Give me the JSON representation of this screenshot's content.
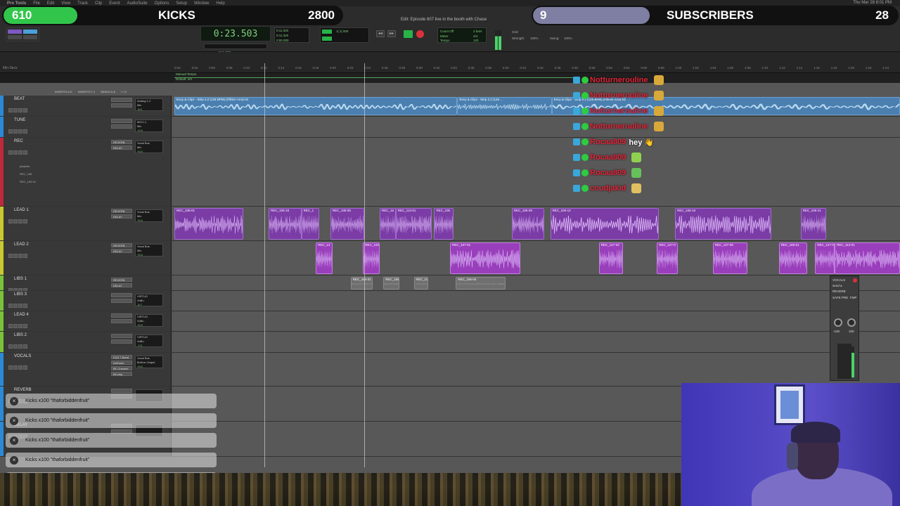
{
  "app": {
    "name": "Pro Tools",
    "window_title": "Edit: Episode 607 live in the booth with Chase",
    "menubar_items": [
      "Pro Tools",
      "File",
      "Edit",
      "View",
      "Track",
      "Clip",
      "Event",
      "AudioSuite",
      "Options",
      "Setup",
      "Window",
      "Help"
    ],
    "clock": "Thu Mar 28 8:01 PM"
  },
  "transport": {
    "main_counter": "0:23.503",
    "sub_start": "0:11.320",
    "sub_end": "0:11.320",
    "length": "0:00.000",
    "cursor": "0:11.320",
    "bars": "1| 1| 000",
    "tempo_labels": [
      "Count Off",
      "Meter",
      "Tempo"
    ],
    "count_off": "2 bars",
    "meter": "4/4",
    "tempo": "120",
    "grid_label": "Grid",
    "nudge_label": "Nudge",
    "strength": "Strength:",
    "strength_val": "100%",
    "swing": "Swing:",
    "swing_val": "100%"
  },
  "overlay": {
    "kicks": {
      "count": "610",
      "label": "KICKS",
      "goal": "2800",
      "accent": "#31c64b",
      "progress": 0.218
    },
    "subscribers": {
      "count": "9",
      "label": "SUBSCRIBERS",
      "goal": "28",
      "accent": "#7e7fa3",
      "progress": 0.32
    }
  },
  "ruler": {
    "rows": [
      "Min:Secs",
      "Tempo",
      "Meter",
      "Markers"
    ],
    "ticks": [
      "0:02",
      "0:04",
      "0:06",
      "0:08",
      "0:10",
      "0:12",
      "0:14",
      "0:16",
      "0:18",
      "0:20",
      "0:22",
      "0:24",
      "0:26",
      "0:28",
      "0:30",
      "0:32",
      "0:34",
      "0:36",
      "0:38",
      "0:40",
      "0:42",
      "0:44",
      "0:46",
      "0:48",
      "0:50",
      "0:52",
      "0:54",
      "0:56",
      "0:58",
      "1:00",
      "1:02",
      "1:04",
      "1:06",
      "1:08",
      "1:10",
      "1:12",
      "1:14",
      "1:16",
      "1:18",
      "1:20",
      "1:22",
      "1:24"
    ],
    "tempo_text": "Manual Tempo",
    "meter_text": "Default: 4/4",
    "col_headers": [
      "INSERTS A-E",
      "INSERTS F-J",
      "SENDS A-E",
      "I / O"
    ]
  },
  "tracks": [
    {
      "name": "BEAT",
      "color": "#2a8ad6",
      "ins": [
        "",
        ""
      ],
      "io": [
        "Analog 1-2",
        "Mix"
      ],
      "vol": "-8.0"
    },
    {
      "name": "TUNE",
      "color": "#2a8ad6",
      "ins": [
        "",
        ""
      ],
      "io": [
        "MIC1-1",
        "Mix"
      ],
      "vol": "+0.0"
    },
    {
      "name": "REC",
      "color": "#c0283c",
      "ins": [
        "REVERB",
        "DELAY"
      ],
      "io": [
        "Vocal Bus",
        "Mix"
      ],
      "vol": "+0.0",
      "sub": [
        "playlists",
        "REC_168",
        "REC_169-01"
      ]
    },
    {
      "name": "LEAD 1",
      "color": "#c8c832",
      "ins": [
        "REVERB",
        "DELAY"
      ],
      "io": [
        "Vocal Bus",
        "Mix"
      ],
      "vol": "+0.0"
    },
    {
      "name": "LEAD 2",
      "color": "#c8c832",
      "ins": [
        "REVERB",
        "DELAY"
      ],
      "io": [
        "Vocal Bus",
        "Mix"
      ],
      "vol": "+0.0"
    },
    {
      "name": "LIBS 1",
      "color": "#7ac23a",
      "ins": [
        "REVERB",
        "DELAY"
      ],
      "io": [
        "VIRTUO",
        "VoBu"
      ],
      "vol": "-7.0"
    },
    {
      "name": "LIBS 3",
      "color": "#7ac23a",
      "ins": [
        "",
        ""
      ],
      "io": [
        "VIRTUO",
        "VoBu"
      ],
      "vol": "-8.7"
    },
    {
      "name": "LEAD 4",
      "color": "#7ac23a",
      "ins": [
        "",
        ""
      ],
      "io": [
        "VIRTUO",
        "VoBu"
      ],
      "vol": "+0.0"
    },
    {
      "name": "LIBS 2",
      "color": "#7ac23a",
      "ins": [
        "",
        ""
      ],
      "io": [
        "VIRTUO",
        "VoBu"
      ],
      "vol": "-7.0"
    },
    {
      "name": "VOCALS",
      "color": "#2a8ad6",
      "ins": [
        "EQ3 7-Band",
        "DeEsser",
        "BF-Channel",
        "BComp"
      ],
      "io": [
        "Vocal Bus",
        "Built-in Output"
      ],
      "vol": "+0.0"
    },
    {
      "name": "REVERB",
      "color": "#2a8ad6",
      "ins": [
        "",
        ""
      ],
      "io": [
        "",
        ""
      ],
      "vol": ""
    },
    {
      "name": "DELAY",
      "color": "#2a8ad6",
      "ins": [
        "",
        ""
      ],
      "io": [
        "",
        ""
      ],
      "vol": ""
    }
  ],
  "clips": [
    {
      "track": 0,
      "name": "Envy & Clipz - Strip 2.2 (126 BPM) (Fillmin Arra)-01",
      "start": 0.0,
      "end": 0.39,
      "color": "blue"
    },
    {
      "track": 0,
      "name": "Envy & Clipz - Strip 2.2 (126 ...",
      "start": 0.39,
      "end": 0.52,
      "color": "blue"
    },
    {
      "track": 0,
      "name": "Envy & Clipz - Strip 2.2 (126 BPM) (Fillmin Arra)-02",
      "start": 0.52,
      "end": 1.0,
      "color": "blue"
    },
    {
      "track": 2,
      "name": "REC_135-01",
      "start": 0.175,
      "end": 0.265,
      "row": 0,
      "color": "purple"
    },
    {
      "track": 2,
      "name": "REC_109-01",
      "start": 0.265,
      "end": 0.37,
      "row": 0,
      "color": "purple"
    },
    {
      "track": 2,
      "name": "REC_131",
      "start": 0.148,
      "end": 0.265,
      "row": 1,
      "color": "violet"
    },
    {
      "track": 2,
      "name": "REC_109-01",
      "start": 0.278,
      "end": 0.357,
      "row": 1,
      "color": "violet"
    },
    {
      "track": 2,
      "name": "REC_118-01",
      "start": 0.466,
      "end": 0.516,
      "row": 0,
      "color": "purple"
    },
    {
      "track": 2,
      "name": "REC_...",
      "start": 0.834,
      "end": 0.86,
      "row": 1,
      "color": "violet"
    },
    {
      "track": 3,
      "name": "REC_105-01",
      "start": 0.0,
      "end": 0.095,
      "color": "lead"
    },
    {
      "track": 3,
      "name": "REC_105-15",
      "start": 0.13,
      "end": 0.175,
      "color": "lead"
    },
    {
      "track": 3,
      "name": "REC_1",
      "start": 0.175,
      "end": 0.2,
      "color": "lead"
    },
    {
      "track": 3,
      "name": "REC_105-05",
      "start": 0.215,
      "end": 0.262,
      "color": "lead"
    },
    {
      "track": 3,
      "name": "REC_15",
      "start": 0.283,
      "end": 0.305,
      "color": "lead"
    },
    {
      "track": 3,
      "name": "REC_113-01",
      "start": 0.305,
      "end": 0.355,
      "color": "lead"
    },
    {
      "track": 3,
      "name": "REC_105",
      "start": 0.358,
      "end": 0.385,
      "color": "lead"
    },
    {
      "track": 3,
      "name": "REC_105-09",
      "start": 0.465,
      "end": 0.51,
      "color": "lead"
    },
    {
      "track": 3,
      "name": "REC_105-12",
      "start": 0.518,
      "end": 0.668,
      "color": "lead"
    },
    {
      "track": 3,
      "name": "REC_105-16",
      "start": 0.69,
      "end": 0.823,
      "color": "lead"
    },
    {
      "track": 3,
      "name": "REC_105-21",
      "start": 0.863,
      "end": 0.898,
      "color": "lead"
    },
    {
      "track": 4,
      "name": "REC_14",
      "start": 0.195,
      "end": 0.218,
      "color": "hot"
    },
    {
      "track": 4,
      "name": "REC_103",
      "start": 0.26,
      "end": 0.283,
      "color": "hot"
    },
    {
      "track": 4,
      "name": "REC_107-01",
      "start": 0.38,
      "end": 0.477,
      "color": "hot"
    },
    {
      "track": 4,
      "name": "REC_127-03",
      "start": 0.585,
      "end": 0.618,
      "color": "hot"
    },
    {
      "track": 4,
      "name": "REC_127-0",
      "start": 0.665,
      "end": 0.694,
      "color": "hot"
    },
    {
      "track": 4,
      "name": "REC_127-06",
      "start": 0.742,
      "end": 0.79,
      "color": "hot"
    },
    {
      "track": 4,
      "name": "REC_169-01",
      "start": 0.833,
      "end": 0.872,
      "color": "hot"
    },
    {
      "track": 4,
      "name": "REC_127-0",
      "start": 0.883,
      "end": 0.91,
      "color": "hot"
    },
    {
      "track": 4,
      "name": "REC_113-01",
      "start": 0.91,
      "end": 1.0,
      "color": "hot"
    },
    {
      "track": 5,
      "name": "REC_164-01",
      "start": 0.243,
      "end": 0.273,
      "color": "grey"
    },
    {
      "track": 5,
      "name": "REC_166",
      "start": 0.288,
      "end": 0.31,
      "color": "grey"
    },
    {
      "track": 5,
      "name": "REC_1C",
      "start": 0.33,
      "end": 0.35,
      "color": "grey"
    },
    {
      "track": 5,
      "name": "REC_165-04",
      "start": 0.388,
      "end": 0.456,
      "color": "grey"
    }
  ],
  "chat": [
    {
      "user": "Notturnerouline",
      "msg": "",
      "emoji": "#d9a83a"
    },
    {
      "user": "Notturnerouline",
      "msg": "",
      "emoji": "#d9a83a"
    },
    {
      "user": "Notturnerouline",
      "msg": "",
      "emoji": "#d9a83a"
    },
    {
      "user": "Notturnerouline",
      "msg": "",
      "emoji": "#d9a83a"
    },
    {
      "user": "Rocaa809",
      "msg": "hey 👋",
      "emoji": ""
    },
    {
      "user": "Rocaa809",
      "msg": "",
      "emoji": "#8fd14f"
    },
    {
      "user": "Rocaa809",
      "msg": "",
      "emoji": "#67c15b"
    },
    {
      "user": "coudjakid",
      "msg": "",
      "emoji": "#e0c060"
    }
  ],
  "notifications": [
    {
      "text": "Kicks x100 \"thaforbiddenfruit\""
    },
    {
      "text": "Kicks x100 \"thaforbiddenfruit\""
    },
    {
      "text": "Kicks x100 \"thaforbiddenfruit\""
    },
    {
      "text": "Kicks x100 \"thaforbiddenfruit\""
    },
    {
      "text": "Kicks x100 \"thaforbiddenfruit\""
    }
  ],
  "mix_popup": {
    "title": "VOCALS",
    "sub": "send a",
    "reverb": "REVERB",
    "labels": [
      "SAFE",
      "PRE",
      "FMP"
    ],
    "values": [
      "-100",
      "100"
    ]
  }
}
